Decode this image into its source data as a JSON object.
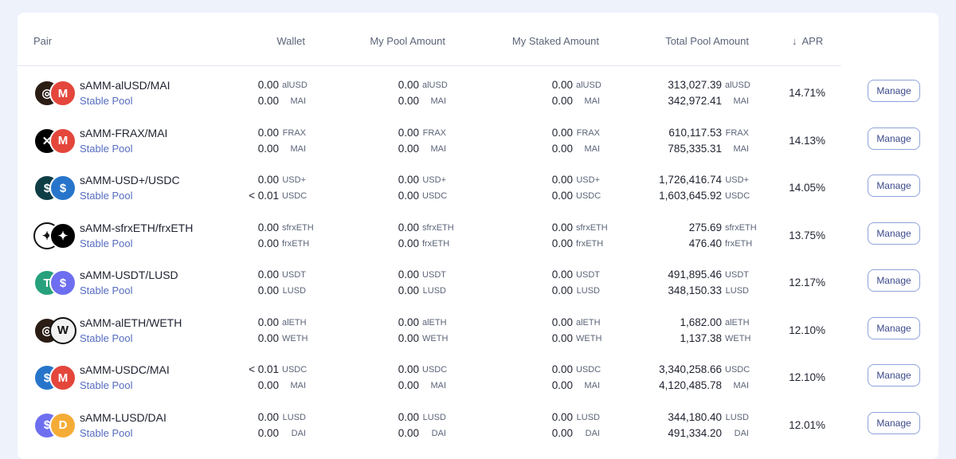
{
  "headers": {
    "pair": "Pair",
    "wallet": "Wallet",
    "my_pool": "My Pool Amount",
    "my_staked": "My Staked Amount",
    "total_pool": "Total Pool Amount",
    "apr": "APR",
    "sort_icon": "↓"
  },
  "manage_label": "Manage",
  "rows": [
    {
      "name": "sAMM-alUSD/MAI",
      "type": "Stable Pool",
      "t1": "alUSD",
      "t2": "MAI",
      "wallet": [
        "0.00",
        "0.00"
      ],
      "pool": [
        "0.00",
        "0.00"
      ],
      "staked": [
        "0.00",
        "0.00"
      ],
      "total": [
        "313,027.39",
        "342,972.41"
      ],
      "apr": "14.71%",
      "icon_a": {
        "glyph": "◎",
        "bg": "#2b1d14",
        "name": "alusd-icon"
      },
      "icon_b": {
        "glyph": "M",
        "bg": "#e4463b",
        "name": "mai-icon"
      }
    },
    {
      "name": "sAMM-FRAX/MAI",
      "type": "Stable Pool",
      "t1": "FRAX",
      "t2": "MAI",
      "wallet": [
        "0.00",
        "0.00"
      ],
      "pool": [
        "0.00",
        "0.00"
      ],
      "staked": [
        "0.00",
        "0.00"
      ],
      "total": [
        "610,117.53",
        "785,335.31"
      ],
      "apr": "14.13%",
      "icon_a": {
        "glyph": "✕",
        "bg": "#000000",
        "name": "frax-icon"
      },
      "icon_b": {
        "glyph": "M",
        "bg": "#e4463b",
        "name": "mai-icon"
      }
    },
    {
      "name": "sAMM-USD+/USDC",
      "type": "Stable Pool",
      "t1": "USD+",
      "t2": "USDC",
      "wallet": [
        "0.00",
        "< 0.01"
      ],
      "pool": [
        "0.00",
        "0.00"
      ],
      "staked": [
        "0.00",
        "0.00"
      ],
      "total": [
        "1,726,416.74",
        "1,603,645.92"
      ],
      "apr": "14.05%",
      "icon_a": {
        "glyph": "$",
        "bg": "#0f3d46",
        "name": "usd-plus-icon"
      },
      "icon_b": {
        "glyph": "$",
        "bg": "#2775ca",
        "name": "usdc-icon"
      }
    },
    {
      "name": "sAMM-sfrxETH/frxETH",
      "type": "Stable Pool",
      "t1": "sfrxETH",
      "t2": "frxETH",
      "wallet": [
        "0.00",
        "0.00"
      ],
      "pool": [
        "0.00",
        "0.00"
      ],
      "staked": [
        "0.00",
        "0.00"
      ],
      "total": [
        "275.69",
        "476.40"
      ],
      "apr": "13.75%",
      "icon_a": {
        "glyph": "✦",
        "bg": "#ffffff",
        "name": "sfrxeth-icon"
      },
      "icon_b": {
        "glyph": "✦",
        "bg": "#000000",
        "name": "frxeth-icon"
      }
    },
    {
      "name": "sAMM-USDT/LUSD",
      "type": "Stable Pool",
      "t1": "USDT",
      "t2": "LUSD",
      "wallet": [
        "0.00",
        "0.00"
      ],
      "pool": [
        "0.00",
        "0.00"
      ],
      "staked": [
        "0.00",
        "0.00"
      ],
      "total": [
        "491,895.46",
        "348,150.33"
      ],
      "apr": "12.17%",
      "icon_a": {
        "glyph": "T",
        "bg": "#26a17b",
        "name": "usdt-icon"
      },
      "icon_b": {
        "glyph": "$",
        "bg": "#6d6ff0",
        "name": "lusd-icon"
      }
    },
    {
      "name": "sAMM-alETH/WETH",
      "type": "Stable Pool",
      "t1": "alETH",
      "t2": "WETH",
      "wallet": [
        "0.00",
        "0.00"
      ],
      "pool": [
        "0.00",
        "0.00"
      ],
      "staked": [
        "0.00",
        "0.00"
      ],
      "total": [
        "1,682.00",
        "1,137.38"
      ],
      "apr": "12.10%",
      "icon_a": {
        "glyph": "◎",
        "bg": "#2b1d14",
        "name": "aleth-icon"
      },
      "icon_b": {
        "glyph": "W",
        "bg": "#f2f2f2",
        "name": "weth-icon"
      }
    },
    {
      "name": "sAMM-USDC/MAI",
      "type": "Stable Pool",
      "t1": "USDC",
      "t2": "MAI",
      "wallet": [
        "< 0.01",
        "0.00"
      ],
      "pool": [
        "0.00",
        "0.00"
      ],
      "staked": [
        "0.00",
        "0.00"
      ],
      "total": [
        "3,340,258.66",
        "4,120,485.78"
      ],
      "apr": "12.10%",
      "icon_a": {
        "glyph": "$",
        "bg": "#2775ca",
        "name": "usdc-icon"
      },
      "icon_b": {
        "glyph": "M",
        "bg": "#e4463b",
        "name": "mai-icon"
      }
    },
    {
      "name": "sAMM-LUSD/DAI",
      "type": "Stable Pool",
      "t1": "LUSD",
      "t2": "DAI",
      "wallet": [
        "0.00",
        "0.00"
      ],
      "pool": [
        "0.00",
        "0.00"
      ],
      "staked": [
        "0.00",
        "0.00"
      ],
      "total": [
        "344,180.40",
        "491,334.20"
      ],
      "apr": "12.01%",
      "icon_a": {
        "glyph": "$",
        "bg": "#6d6ff0",
        "name": "lusd-icon"
      },
      "icon_b": {
        "glyph": "D",
        "bg": "#f5ac37",
        "name": "dai-icon"
      }
    }
  ]
}
